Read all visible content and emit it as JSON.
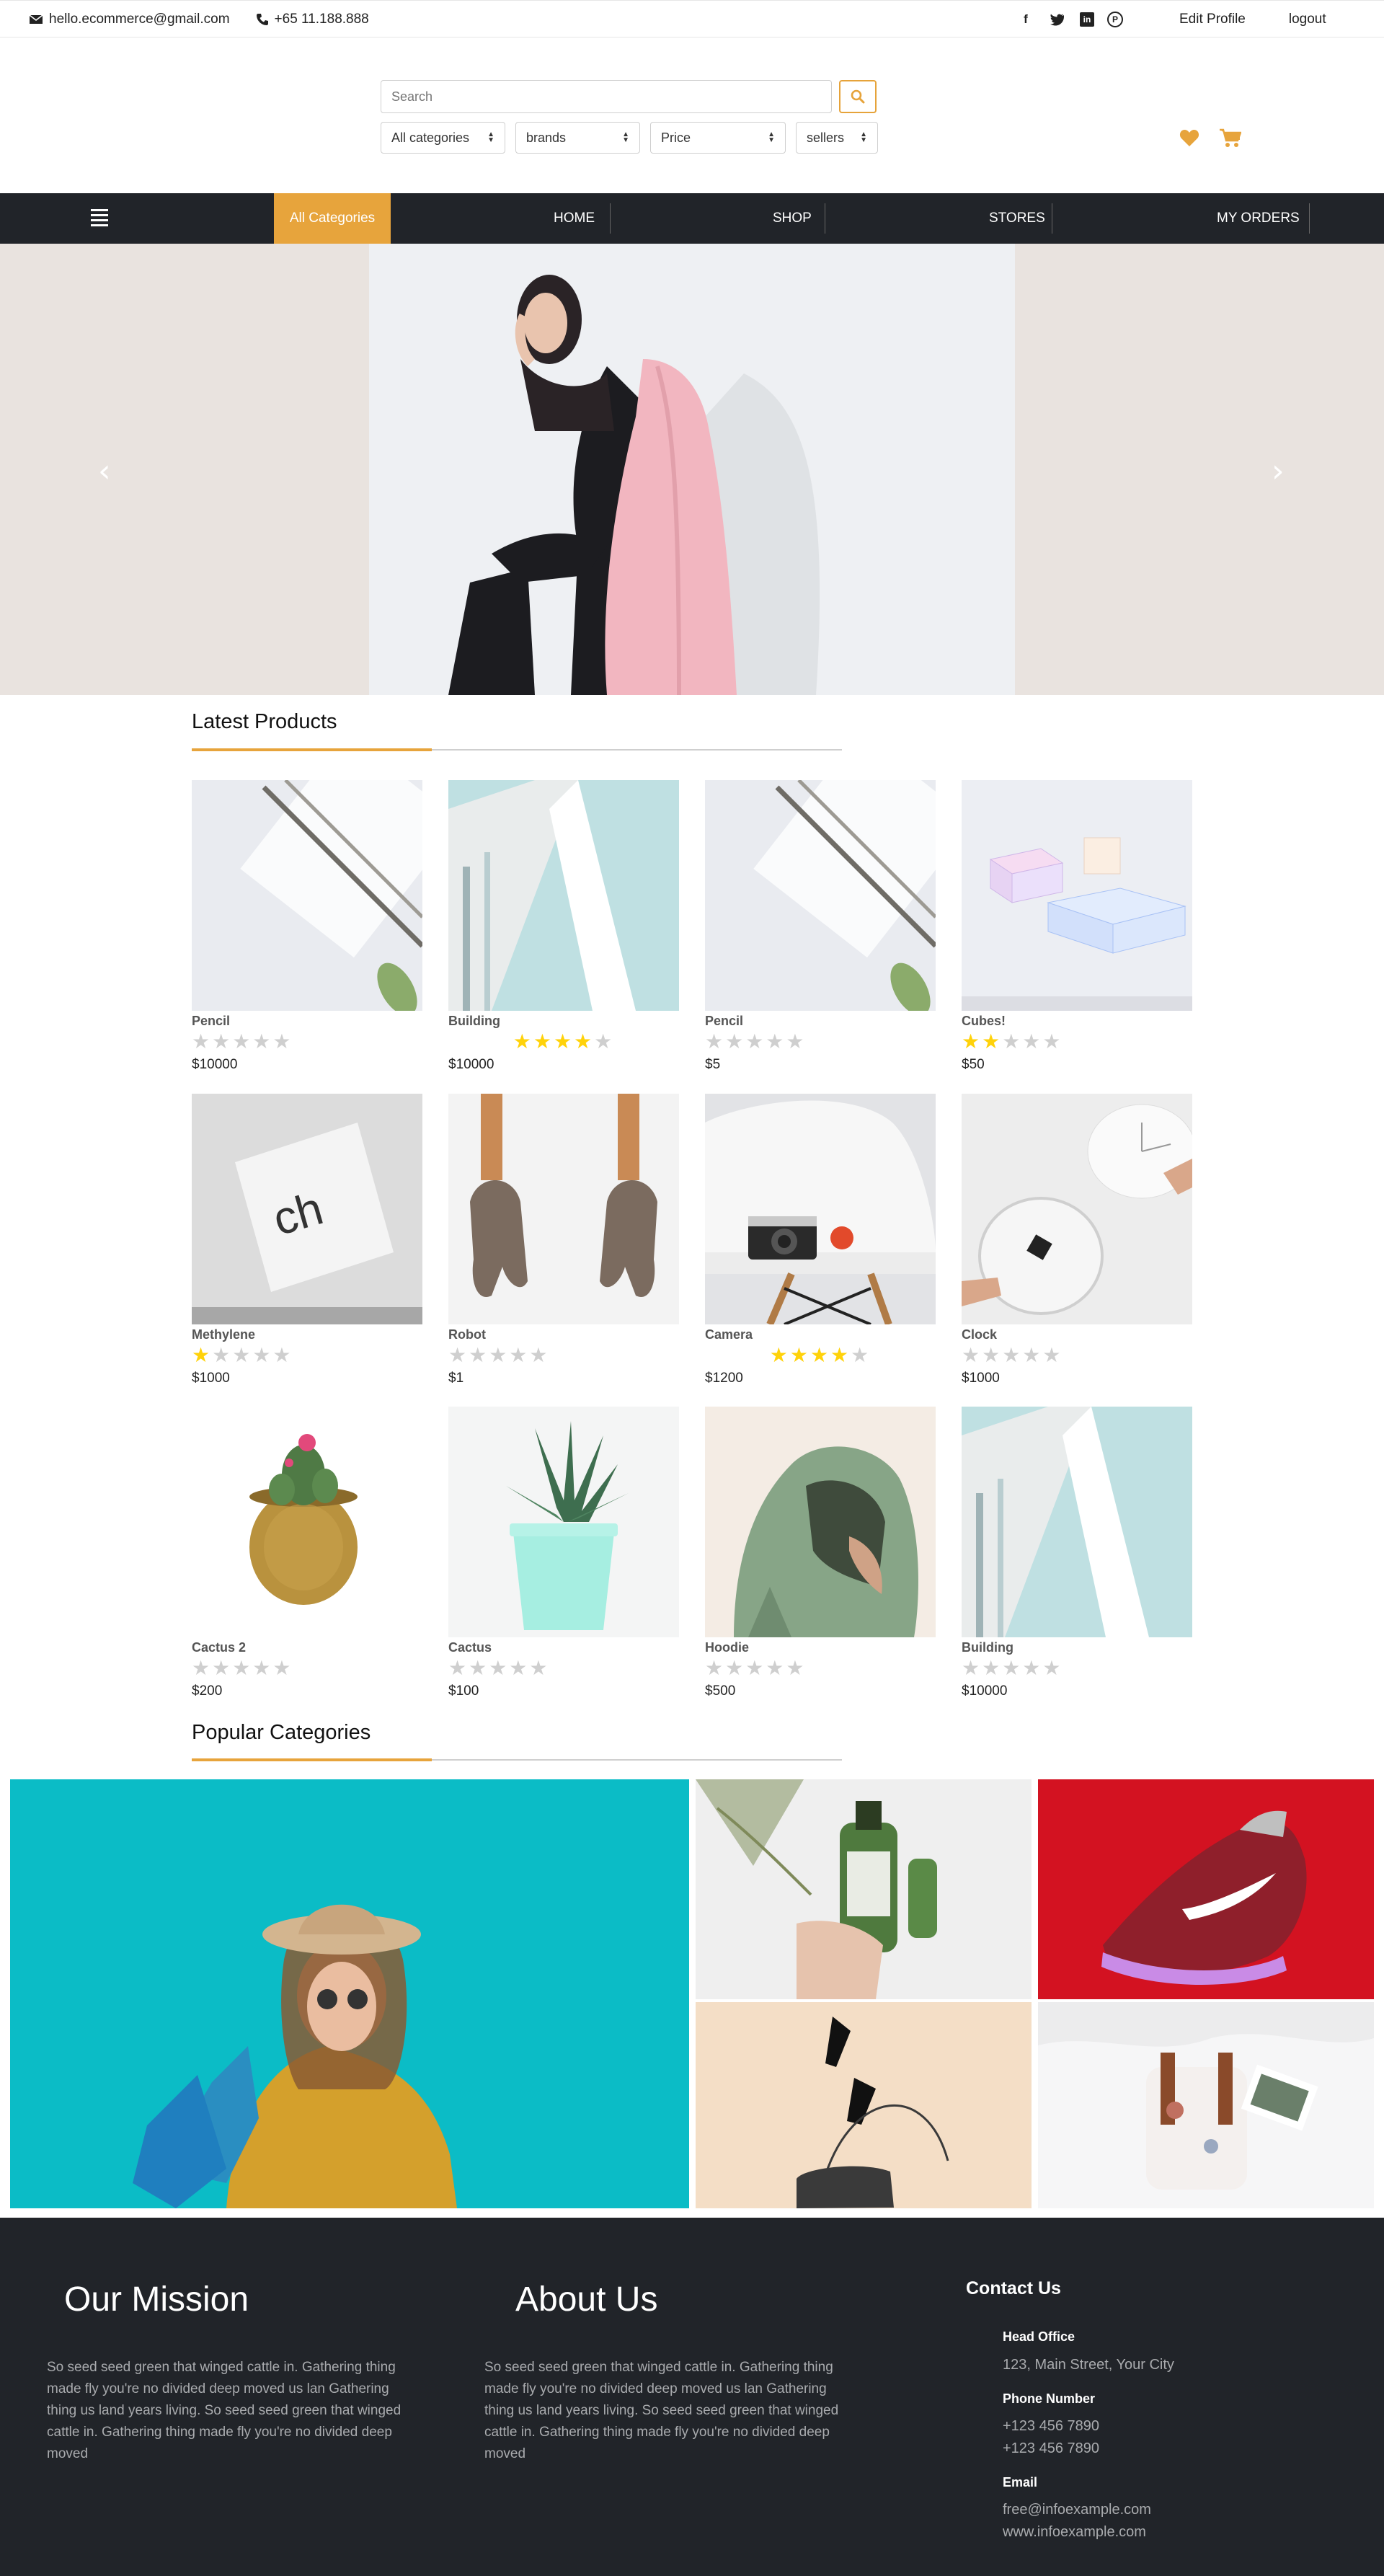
{
  "topbar": {
    "email": "hello.ecommerce@gmail.com",
    "phone": "+65 11.188.888",
    "social_icons": [
      "facebook-icon",
      "twitter-icon",
      "linkedin-icon",
      "pinterest-icon"
    ],
    "edit_profile": "Edit Profile",
    "logout": "logout"
  },
  "header": {
    "search_placeholder": "Search",
    "filters": [
      "All categories",
      "brands",
      "Price",
      "sellers"
    ],
    "icons": [
      "heart-icon",
      "cart-icon"
    ],
    "accent_color": "#e7a43c"
  },
  "nav": {
    "all_categories": "All Categories",
    "items": [
      "HOME",
      "SHOP",
      "STORES",
      "MY ORDERS"
    ]
  },
  "hero": {
    "prev_label": "‹",
    "next_label": "›"
  },
  "latest": {
    "title": "Latest Products",
    "products": [
      {
        "name": "Pencil",
        "price": "$10000",
        "rating": 0
      },
      {
        "name": "Building",
        "price": "$10000",
        "rating": 4
      },
      {
        "name": "Pencil",
        "price": "$5",
        "rating": 0
      },
      {
        "name": "Cubes!",
        "price": "$50",
        "rating": 2
      },
      {
        "name": "Methylene",
        "price": "$1000",
        "rating": 1
      },
      {
        "name": "Robot",
        "price": "$1",
        "rating": 0
      },
      {
        "name": "Camera",
        "price": "$1200",
        "rating": 4
      },
      {
        "name": "Clock",
        "price": "$1000",
        "rating": 0
      },
      {
        "name": "Cactus 2",
        "price": "$200",
        "rating": 0
      },
      {
        "name": "Cactus",
        "price": "$100",
        "rating": 0
      },
      {
        "name": "Hoodie",
        "price": "$500",
        "rating": 0
      },
      {
        "name": "Building",
        "price": "$10000",
        "rating": 0
      }
    ]
  },
  "popular": {
    "title": "Popular Categories"
  },
  "footer": {
    "mission_title": "Our Mission",
    "mission_text": "So seed seed green that winged cattle in. Gathering thing made fly you're no divided deep moved us lan Gathering thing us land years living. So seed seed green that winged cattle in. Gathering thing made fly you're no divided deep moved",
    "about_title": "About Us",
    "about_text": "So seed seed green that winged cattle in. Gathering thing made fly you're no divided deep moved us lan Gathering thing us land years living. So seed seed green that winged cattle in. Gathering thing made fly you're no divided deep moved",
    "contact_title": "Contact Us",
    "head_office_label": "Head Office",
    "address": "123, Main Street, Your City",
    "phone_label": "Phone Number",
    "phone1": "+123 456 7890",
    "phone2": "+123 456 7890",
    "email_label": "Email",
    "email": "free@infoexample.com",
    "website": "www.infoexample.com"
  }
}
